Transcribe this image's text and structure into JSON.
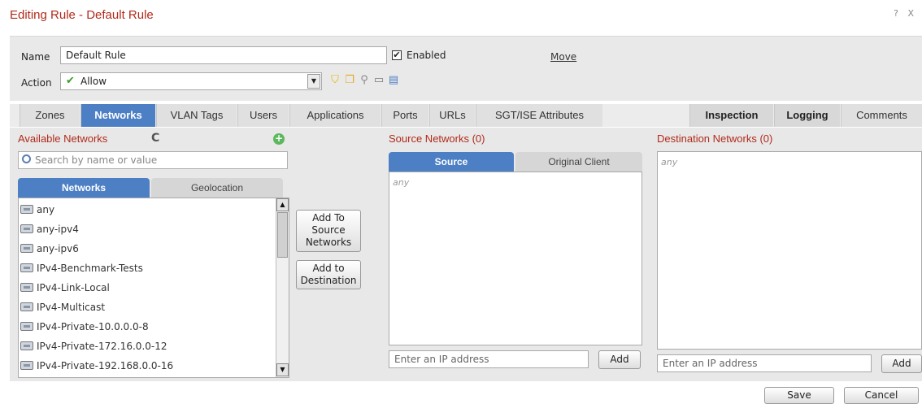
{
  "dialog": {
    "title": "Editing Rule - Default Rule",
    "help_icon": "? X"
  },
  "rule": {
    "name_label": "Name",
    "name_value": "Default Rule",
    "enabled_label": "Enabled",
    "enabled_checked": "✔",
    "move_label": "Move",
    "action_label": "Action",
    "action_value": "Allow",
    "action_icons": [
      "shield-icon",
      "copy-icon",
      "user-search-icon",
      "folder-icon",
      "document-icon"
    ]
  },
  "tabs": {
    "left": [
      "Zones",
      "Networks",
      "VLAN Tags",
      "Users",
      "Applications",
      "Ports",
      "URLs",
      "SGT/ISE Attributes"
    ],
    "active": "Networks",
    "right": [
      "Inspection",
      "Logging",
      "Comments"
    ]
  },
  "available": {
    "header": "Available Networks",
    "refresh_icon": "C",
    "add_icon": "+",
    "search_placeholder": "Search by name or value",
    "subtab_networks": "Networks",
    "subtab_geolocation": "Geolocation",
    "items": [
      "any",
      "any-ipv4",
      "any-ipv6",
      "IPv4-Benchmark-Tests",
      "IPv4-Link-Local",
      "IPv4-Multicast",
      "IPv4-Private-10.0.0.0-8",
      "IPv4-Private-172.16.0.0-12",
      "IPv4-Private-192.168.0.0-16"
    ]
  },
  "buttons": {
    "add_to_source": "Add To Source Networks",
    "add_to_destination": "Add to Destination"
  },
  "source": {
    "header": "Source Networks (0)",
    "subtab_source": "Source",
    "subtab_original": "Original Client",
    "empty_value": "any",
    "ip_placeholder": "Enter an IP address",
    "add_label": "Add"
  },
  "destination": {
    "header": "Destination Networks (0)",
    "empty_value": "any",
    "ip_placeholder": "Enter an IP address",
    "add_label": "Add"
  },
  "footer": {
    "save_label": "Save",
    "cancel_label": "Cancel"
  },
  "colors": {
    "accent_blue": "#4d7fc4",
    "title_red": "#b02a1a",
    "allow_green": "#3c9b2c"
  }
}
